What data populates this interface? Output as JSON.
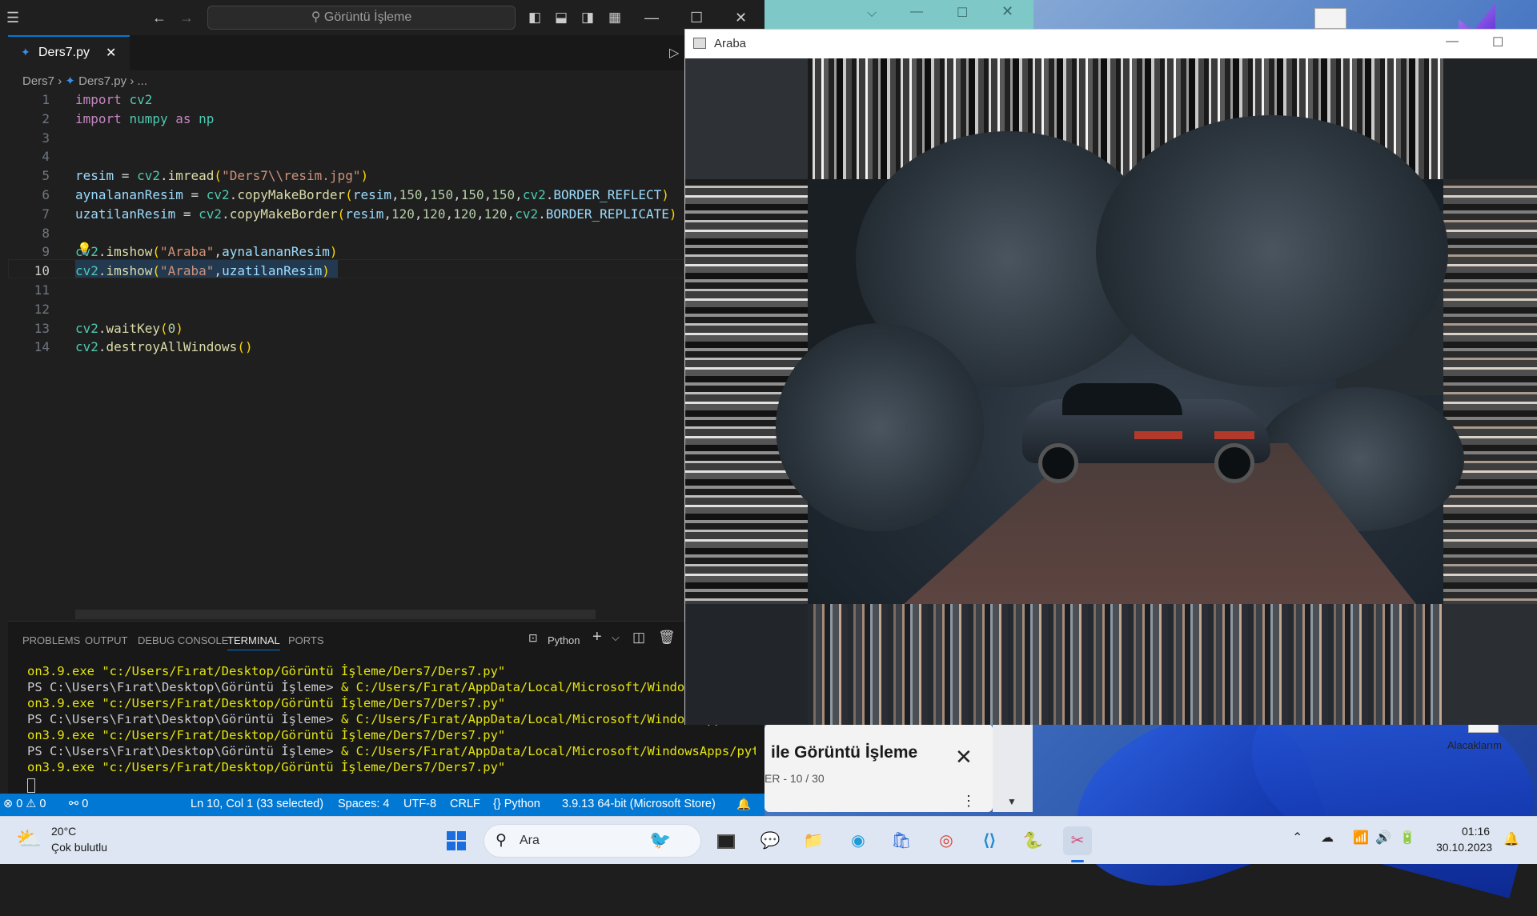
{
  "vscode": {
    "command_center": "Görüntü İşleme",
    "tab": {
      "icon": "python-file-icon",
      "label": "Ders7.py"
    },
    "breadcrumb": {
      "folder": "Ders7",
      "file": "Ders7.py",
      "rest": "..."
    },
    "code_lines": [
      {
        "n": "1",
        "segs": [
          [
            "kw",
            "import"
          ],
          [
            "pun",
            " "
          ],
          [
            "mod",
            "cv2"
          ]
        ]
      },
      {
        "n": "2",
        "segs": [
          [
            "kw",
            "import"
          ],
          [
            "pun",
            " "
          ],
          [
            "mod",
            "numpy"
          ],
          [
            "pun",
            " "
          ],
          [
            "kw",
            "as"
          ],
          [
            "pun",
            " "
          ],
          [
            "mod",
            "np"
          ]
        ]
      },
      {
        "n": "3",
        "segs": []
      },
      {
        "n": "4",
        "segs": []
      },
      {
        "n": "5",
        "segs": [
          [
            "var",
            "resim"
          ],
          [
            "pun",
            " = "
          ],
          [
            "mod",
            "cv2"
          ],
          [
            "pun",
            "."
          ],
          [
            "fn",
            "imread"
          ],
          [
            "br",
            "("
          ],
          [
            "str",
            "\"Ders7\\\\resim.jpg\""
          ],
          [
            "br",
            ")"
          ]
        ]
      },
      {
        "n": "6",
        "segs": [
          [
            "var",
            "aynalananResim"
          ],
          [
            "pun",
            " = "
          ],
          [
            "mod",
            "cv2"
          ],
          [
            "pun",
            "."
          ],
          [
            "fn",
            "copyMakeBorder"
          ],
          [
            "br",
            "("
          ],
          [
            "var",
            "resim"
          ],
          [
            "pun",
            ","
          ],
          [
            "num",
            "150"
          ],
          [
            "pun",
            ","
          ],
          [
            "num",
            "150"
          ],
          [
            "pun",
            ","
          ],
          [
            "num",
            "150"
          ],
          [
            "pun",
            ","
          ],
          [
            "num",
            "150"
          ],
          [
            "pun",
            ","
          ],
          [
            "mod",
            "cv2"
          ],
          [
            "pun",
            "."
          ],
          [
            "var",
            "BORDER_REFLECT"
          ],
          [
            "br",
            ")"
          ]
        ]
      },
      {
        "n": "7",
        "segs": [
          [
            "var",
            "uzatilanResim"
          ],
          [
            "pun",
            " = "
          ],
          [
            "mod",
            "cv2"
          ],
          [
            "pun",
            "."
          ],
          [
            "fn",
            "copyMakeBorder"
          ],
          [
            "br",
            "("
          ],
          [
            "var",
            "resim"
          ],
          [
            "pun",
            ","
          ],
          [
            "num",
            "120"
          ],
          [
            "pun",
            ","
          ],
          [
            "num",
            "120"
          ],
          [
            "pun",
            ","
          ],
          [
            "num",
            "120"
          ],
          [
            "pun",
            ","
          ],
          [
            "num",
            "120"
          ],
          [
            "pun",
            ","
          ],
          [
            "mod",
            "cv2"
          ],
          [
            "pun",
            "."
          ],
          [
            "var",
            "BORDER_REPLICATE"
          ],
          [
            "br",
            ")"
          ]
        ]
      },
      {
        "n": "8",
        "segs": []
      },
      {
        "n": "9",
        "segs": [
          [
            "mod",
            "cv2"
          ],
          [
            "pun",
            "."
          ],
          [
            "fn",
            "imshow"
          ],
          [
            "br",
            "("
          ],
          [
            "str",
            "\"Araba\""
          ],
          [
            "pun",
            ","
          ],
          [
            "var",
            "aynalananResim"
          ],
          [
            "br",
            ")"
          ]
        ]
      },
      {
        "n": "10",
        "segs": [
          [
            "mod",
            "cv2"
          ],
          [
            "pun",
            "."
          ],
          [
            "fn",
            "imshow"
          ],
          [
            "br",
            "("
          ],
          [
            "str",
            "\"Araba\""
          ],
          [
            "pun",
            ","
          ],
          [
            "var",
            "uzatilanResim"
          ],
          [
            "br",
            ")"
          ]
        ]
      },
      {
        "n": "11",
        "segs": []
      },
      {
        "n": "12",
        "segs": []
      },
      {
        "n": "13",
        "segs": [
          [
            "mod",
            "cv2"
          ],
          [
            "pun",
            "."
          ],
          [
            "fn",
            "waitKey"
          ],
          [
            "br",
            "("
          ],
          [
            "num",
            "0"
          ],
          [
            "br",
            ")"
          ]
        ]
      },
      {
        "n": "14",
        "segs": [
          [
            "mod",
            "cv2"
          ],
          [
            "pun",
            "."
          ],
          [
            "fn",
            "destroyAllWindows"
          ],
          [
            "br",
            "()"
          ]
        ]
      }
    ],
    "panel_tabs": [
      "PROBLEMS",
      "OUTPUT",
      "DEBUG CONSOLE",
      "TERMINAL",
      "PORTS"
    ],
    "active_panel_tab": "TERMINAL",
    "terminal_profile": "Python",
    "terminal_lines": [
      {
        "dot": "",
        "prompt": "",
        "cmd": "on3.9.exe \"c:/Users/Fırat/Desktop/Görüntü İşleme/Ders7/Ders7.py\""
      },
      {
        "dot": "●",
        "prompt": "PS C:\\Users\\Fırat\\Desktop\\Görüntü İşleme> ",
        "cmd": "& C:/Users/Fırat/AppData/Local/Microsoft/WindowsA"
      },
      {
        "dot": "",
        "prompt": "",
        "cmd": "on3.9.exe \"c:/Users/Fırat/Desktop/Görüntü İşleme/Ders7/Ders7.py\""
      },
      {
        "dot": "●",
        "prompt": "PS C:\\Users\\Fırat\\Desktop\\Görüntü İşleme> ",
        "cmd": "& C:/Users/Fırat/AppData/Local/Microsoft/WindowsApp"
      },
      {
        "dot": "",
        "prompt": "",
        "cmd": "on3.9.exe \"c:/Users/Fırat/Desktop/Görüntü İşleme/Ders7/Ders7.py\""
      },
      {
        "dot": "○",
        "prompt": "PS C:\\Users\\Fırat\\Desktop\\Görüntü İşleme> ",
        "cmd": "& C:/Users/Fırat/AppData/Local/Microsoft/WindowsApps/pyth"
      },
      {
        "dot": "",
        "prompt": "",
        "cmd": "on3.9.exe \"c:/Users/Fırat/Desktop/Görüntü İşleme/Ders7/Ders7.py\""
      }
    ],
    "status": {
      "errors": "0",
      "warnings": "0",
      "ports": "0",
      "cursor": "Ln 10, Col 1 (33 selected)",
      "spaces": "Spaces: 4",
      "encoding": "UTF-8",
      "eol": "CRLF",
      "language": "Python",
      "interpreter": "3.9.13 64-bit (Microsoft Store)"
    }
  },
  "image_window": {
    "title": "Araba"
  },
  "notification": {
    "title": "ile Görüntü İşleme",
    "sub": "ER - 10 / 30"
  },
  "desktop": {
    "received_label": "Alacaklarım"
  },
  "taskbar": {
    "weather_temp": "20°C",
    "weather_desc": "Çok bulutlu",
    "search_placeholder": "Ara",
    "time": "01:16",
    "date": "30.10.2023"
  },
  "colors": {
    "accent": "#0078d4",
    "terminal_yellow": "#e5e510"
  }
}
